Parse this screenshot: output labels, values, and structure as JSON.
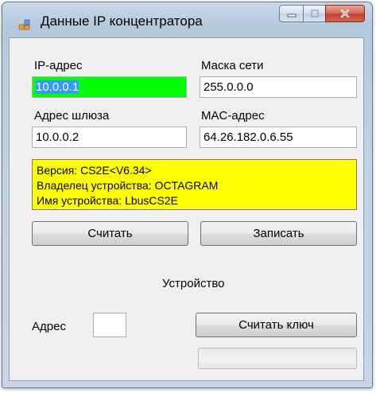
{
  "window": {
    "title": "Данные IP концентратора",
    "caption_buttons": [
      "minimize-icon",
      "maximize-icon",
      "close-icon"
    ]
  },
  "network": {
    "ip_label": "IP-адрес",
    "ip_value": "10.0.0.1",
    "mask_label": "Маска сети",
    "mask_value": "255.0.0.0",
    "gateway_label": "Адрес шлюза",
    "gateway_value": "10.0.0.2",
    "mac_label": "MAC-адрес",
    "mac_value": "64.26.182.0.6.55"
  },
  "info": {
    "version": "Версия: CS2E<V6.34>",
    "owner": "Владелец устройства: OCTAGRAM",
    "device_name": "Имя устройства: LbusCS2E",
    "background_color": "#ffff00"
  },
  "actions": {
    "read_label": "Считать",
    "write_label": "Записать"
  },
  "device": {
    "section_label": "Устройство",
    "address_label": "Адрес",
    "address_value": "",
    "read_key_label": "Считать ключ",
    "progress": 0
  },
  "colors": {
    "ip_highlight": "#00ff00",
    "selection": "#3399ff",
    "close_button": "#c0412d"
  }
}
